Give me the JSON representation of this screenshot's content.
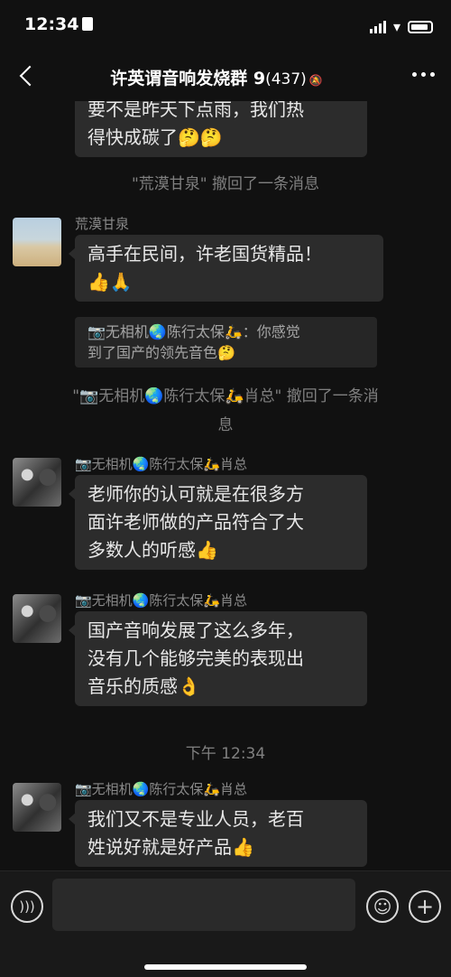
{
  "status_bar": {
    "time": "12:34"
  },
  "nav": {
    "title": "许英谓音响发烧群 9",
    "member_count": "(437)"
  },
  "messages": {
    "top_partial": {
      "line1": "要不是昨天下点雨，我们热",
      "line2": "得快成碳了🤔🤔"
    },
    "recall_1": "\"荒漠甘泉\" 撤回了一条消息",
    "msg_a": {
      "sender": "荒漠甘泉",
      "line1": "高手在民间，许老国货精品！",
      "line2": "👍🙏"
    },
    "quote_a": {
      "line1": "📷无相机🌏陈行太保🛵：你感觉",
      "line2": "到了国产的领先音色🤔"
    },
    "recall_2": {
      "line1": "\"📷无相机🌏陈行太保🛵肖总\" 撤回了一条消",
      "line2": "息"
    },
    "msg_b": {
      "sender": "📷无相机🌏陈行太保🛵肖总",
      "line1": "老师你的认可就是在很多方",
      "line2": "面许老师做的产品符合了大",
      "line3": "多数人的听感👍"
    },
    "msg_c": {
      "sender": "📷无相机🌏陈行太保🛵肖总",
      "line1": "国产音响发展了这么多年，",
      "line2": "没有几个能够完美的表现出",
      "line3": "音乐的质感👌"
    },
    "time_label": "下午 12:34",
    "msg_d": {
      "sender": "📷无相机🌏陈行太保🛵肖总",
      "line1": "我们又不是专业人员，老百",
      "line2": "姓说好就是好产品👍"
    }
  },
  "input_bar": {
    "value": "",
    "voice_icon": "voice-icon",
    "emoji_icon": "emoji-icon",
    "plus_icon": "plus-icon"
  }
}
